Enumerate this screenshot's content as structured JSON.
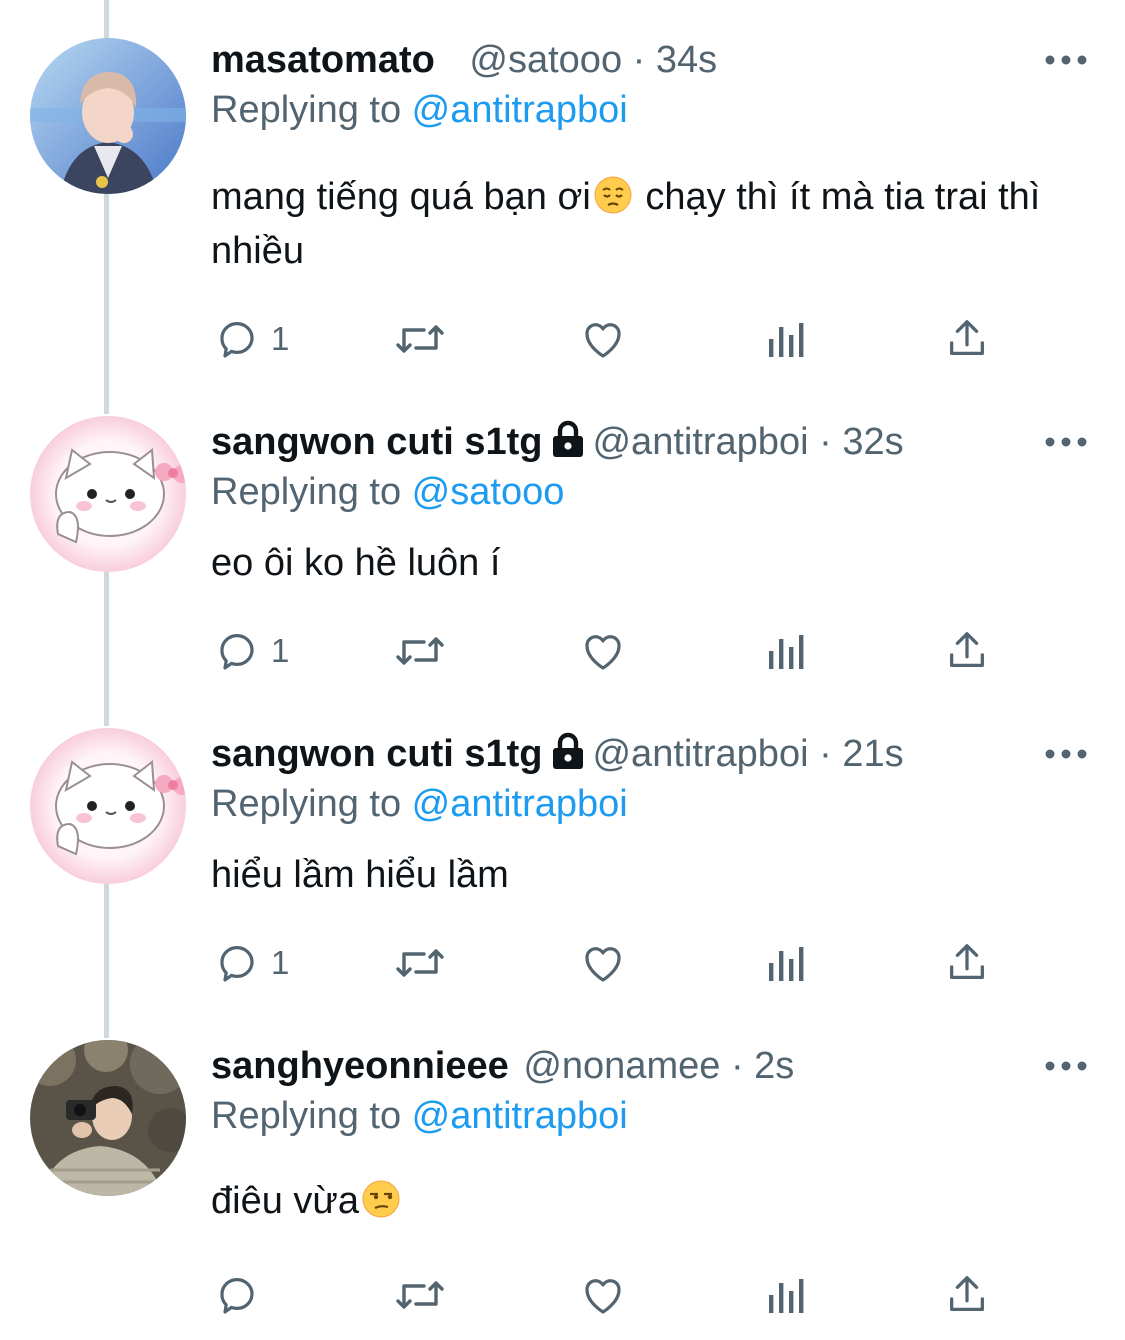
{
  "tweets": [
    {
      "name": "masatomato",
      "handle": "@satooo",
      "dot": "·",
      "time": "34s",
      "replying_prefix": "Replying to ",
      "replying_to": "@antitrapboi",
      "text_before_emoji": "mang tiếng quá bạn ơi",
      "emoji": "pensive-face-emoji",
      "text_after_emoji": " chạy thì ít mà tia trai thì nhiều",
      "reply_count": "1",
      "locked": false
    },
    {
      "name": "sangwon cuti s1tg",
      "handle": "@antitrapboi",
      "dot": "·",
      "time": "32s",
      "replying_prefix": "Replying to ",
      "replying_to": "@satooo",
      "text": "eo ôi ko hề luôn í",
      "reply_count": "1",
      "locked": true
    },
    {
      "name": "sangwon cuti s1tg",
      "handle": "@antitrapboi",
      "dot": "·",
      "time": "21s",
      "replying_prefix": "Replying to ",
      "replying_to": "@antitrapboi",
      "text": "hiểu lầm hiểu lầm",
      "reply_count": "1",
      "locked": true
    },
    {
      "name": "sanghyeonnieee",
      "handle": "@nonamee",
      "dot": "·",
      "time": "2s",
      "replying_prefix": "Replying to ",
      "replying_to": "@antitrapboi",
      "text_before_emoji": "điêu vừa",
      "emoji": "unamused-face-emoji",
      "reply_count": "",
      "locked": false
    }
  ],
  "icons": {
    "reply": "reply-icon",
    "retweet": "retweet-icon",
    "like": "heart-icon",
    "views": "analytics-icon",
    "share": "share-icon",
    "more": "more-icon",
    "lock": "lock-icon"
  },
  "colors": {
    "text": "#0f1419",
    "secondary": "#536471",
    "link": "#1d9bf0",
    "thread_line": "#cfd9de"
  }
}
